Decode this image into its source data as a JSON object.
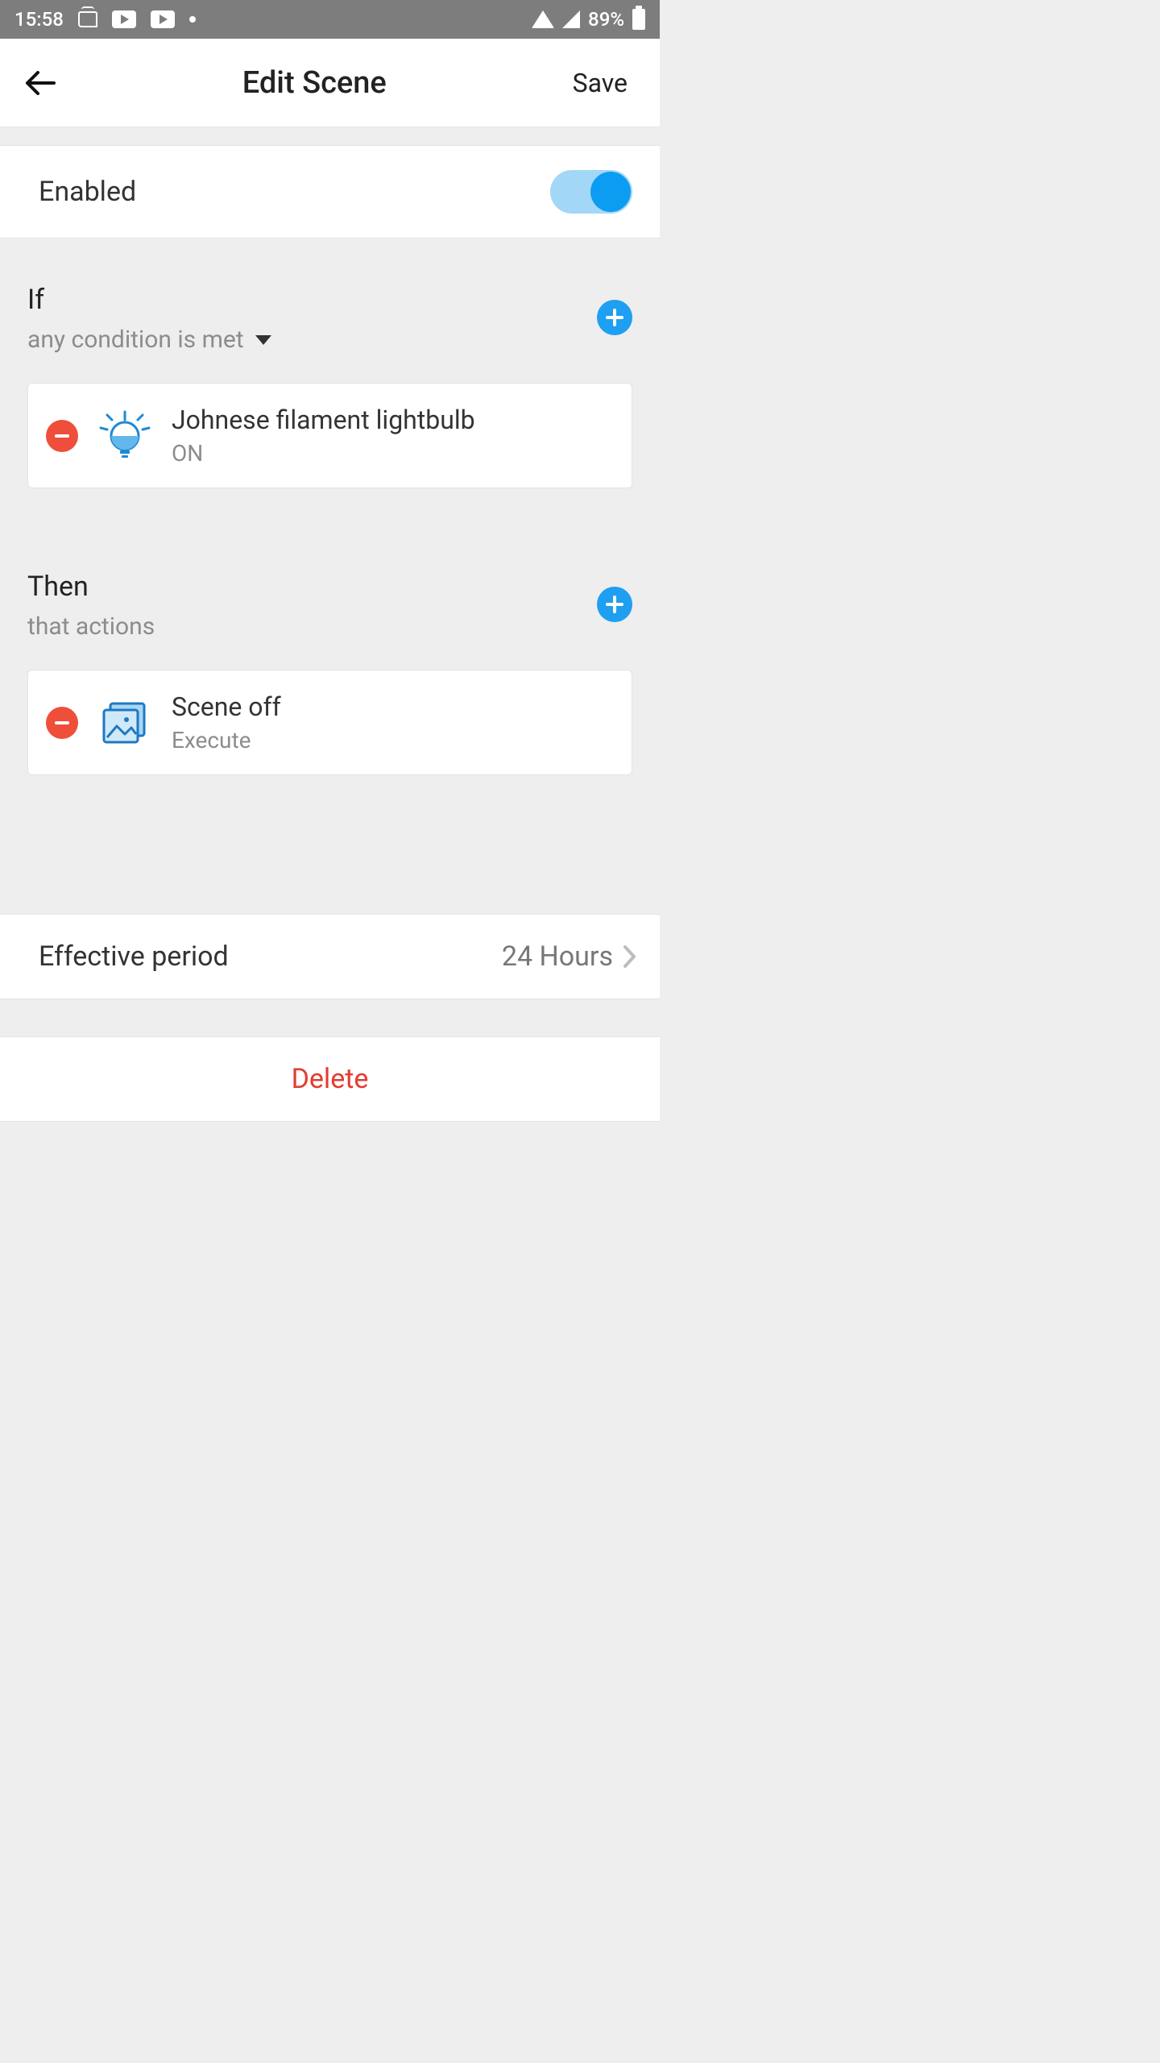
{
  "statusbar": {
    "time": "15:58",
    "battery": "89%"
  },
  "header": {
    "title": "Edit Scene",
    "save": "Save"
  },
  "enabled": {
    "label": "Enabled",
    "on": true
  },
  "if_section": {
    "title": "If",
    "subtitle": "any condition is met",
    "condition": {
      "title": "Johnese filament lightbulb",
      "state": "ON"
    }
  },
  "then_section": {
    "title": "Then",
    "subtitle": "that actions",
    "action": {
      "title": "Scene off",
      "state": "Execute"
    }
  },
  "effective": {
    "label": "Effective period",
    "value": "24 Hours"
  },
  "delete": "Delete"
}
